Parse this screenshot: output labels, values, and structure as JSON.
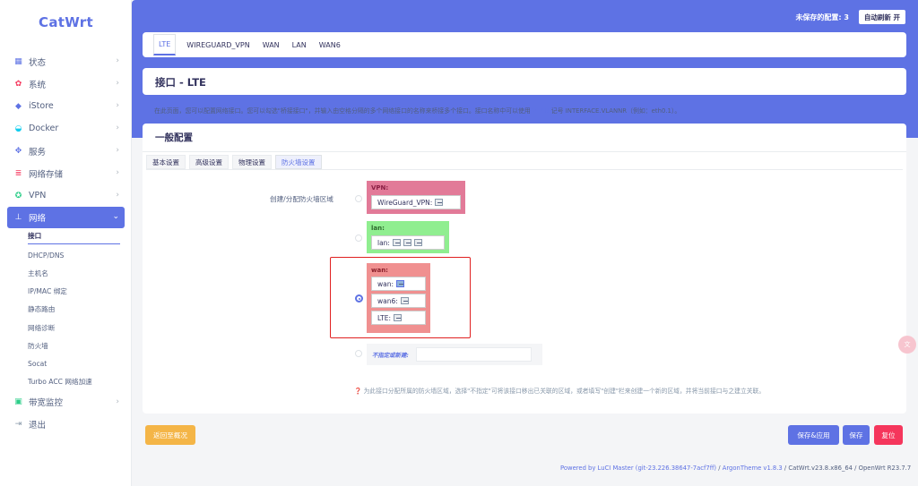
{
  "app": {
    "logo": "CatWrt"
  },
  "header": {
    "unsaved": "未保存的配置: 3",
    "auto_refresh": "自动刷新 开"
  },
  "sidebar": {
    "items": [
      {
        "label": "状态",
        "icon": "dashboard-icon",
        "color": "#5e72e4"
      },
      {
        "label": "系统",
        "icon": "gear-icon",
        "color": "#f5365c"
      },
      {
        "label": "iStore",
        "icon": "cube-icon",
        "color": "#5e72e4"
      },
      {
        "label": "Docker",
        "icon": "docker-icon",
        "color": "#11cdef"
      },
      {
        "label": "服务",
        "icon": "puzzle-icon",
        "color": "#5e72e4"
      },
      {
        "label": "网络存储",
        "icon": "storage-icon",
        "color": "#f5365c"
      },
      {
        "label": "VPN",
        "icon": "vpn-icon",
        "color": "#2dce89"
      },
      {
        "label": "网络",
        "icon": "network-icon",
        "color": "#ffffff"
      },
      {
        "label": "带宽监控",
        "icon": "monitor-icon",
        "color": "#2dce89"
      },
      {
        "label": "退出",
        "icon": "logout-icon",
        "color": "#8898aa"
      }
    ],
    "submenu": [
      {
        "label": "接口"
      },
      {
        "label": "DHCP/DNS"
      },
      {
        "label": "主机名"
      },
      {
        "label": "IP/MAC 绑定"
      },
      {
        "label": "静态路由"
      },
      {
        "label": "网络诊断"
      },
      {
        "label": "防火墙"
      },
      {
        "label": "Socat"
      },
      {
        "label": "Turbo ACC 网络加速"
      }
    ]
  },
  "tabs": [
    "LTE",
    "WIREGUARD_VPN",
    "WAN",
    "LAN",
    "WAN6"
  ],
  "page": {
    "title": "接口 - LTE",
    "description_main": "在此页面，您可以配置网络接口。您可以勾选\"桥接接口\"，并输入由空格分隔的多个网络接口的名称来桥接多个接口。接口名称中可以使用",
    "description_vlan": "VLAN",
    "description_tail": "记号 INTERFACE.VLANNR（例如：eth0.1）。"
  },
  "config": {
    "title": "一般配置",
    "subtabs": [
      "基本设置",
      "高级设置",
      "物理设置",
      "防火墙设置"
    ],
    "zone_label": "创建/分配防火墙区域",
    "zones": {
      "vpn": {
        "name": "VPN:",
        "nets": [
          "WireGuard_VPN:"
        ]
      },
      "lan": {
        "name": "lan:",
        "nets": [
          "lan:"
        ]
      },
      "wan": {
        "name": "wan:",
        "nets": [
          "wan:",
          "wan6:",
          "LTE:"
        ]
      }
    },
    "new_zone_label": "不指定或新建:",
    "hint": "❓ 为此接口分配所属的防火墙区域，选择\"不指定\"可将该接口移出已关联的区域，或者填写\"创建\"栏来创建一个新的区域，并将当前接口与之建立关联。"
  },
  "buttons": {
    "back": "返回至概况",
    "save_apply": "保存&应用",
    "save": "保存",
    "reset": "复位"
  },
  "footer": {
    "link1": "Powered by LuCI Master (git-23.226.38647-7acf7ff)",
    "sep1": " / ",
    "link2": "ArgonTheme v1.8.3",
    "rest": " / CatWrt.v23.8.x86_64 / OpenWrt R23.7.7"
  },
  "colors": {
    "accent": "#5e72e4",
    "vpn_zone": "#e27a98",
    "lan_zone": "#90ee90",
    "wan_zone": "#f09090",
    "highlight": "#e02020"
  }
}
